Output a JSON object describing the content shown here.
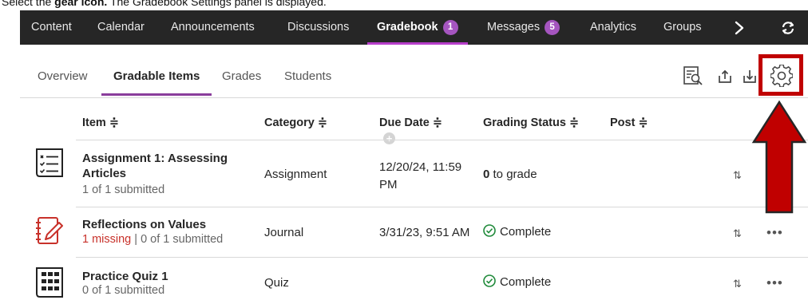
{
  "caption": {
    "prefix": "Select the",
    "bold": "gear icon.",
    "rest": "The Gradebook Settings panel is displayed."
  },
  "top_nav": {
    "tabs": [
      {
        "label": "Content"
      },
      {
        "label": "Calendar"
      },
      {
        "label": "Announcements"
      },
      {
        "label": "Discussions"
      },
      {
        "label": "Gradebook",
        "badge": "1",
        "active": true
      },
      {
        "label": "Messages",
        "badge": "5"
      },
      {
        "label": "Analytics"
      },
      {
        "label": "Groups"
      }
    ],
    "more_icon": "chevron-right-icon",
    "refresh_icon": "refresh-icon"
  },
  "sub_nav": {
    "tabs": [
      {
        "label": "Overview"
      },
      {
        "label": "Gradable Items",
        "active": true
      },
      {
        "label": "Grades"
      },
      {
        "label": "Students"
      }
    ]
  },
  "toolbar": {
    "icons": [
      "review-search-icon",
      "export-icon",
      "import-icon",
      "gear-icon"
    ],
    "highlight_color": "#c00000"
  },
  "table": {
    "headers": {
      "item": "Item ≑",
      "category": "Category ≑",
      "due_date": "Due Date ≑",
      "grading_status": "Grading Status ≑",
      "post": "Post ≑"
    },
    "add_icon": "+",
    "rows": [
      {
        "icon": "assignment-checklist-icon",
        "title": "Assignment 1: Assessing Articles",
        "submitted": "1 of 1 submitted",
        "category": "Assignment",
        "due_date": "12/20/24, 11:59 PM",
        "grade_count": "0",
        "grade_text": " to grade",
        "actions": "⇅"
      },
      {
        "icon": "journal-icon",
        "title": "Reflections on Values",
        "missing": "1 missing",
        "separator": " | ",
        "submitted": "0 of 1 submitted",
        "category": "Journal",
        "due_date": "3/31/23, 9:51 AM",
        "status": "Complete",
        "actions": "⇅",
        "more": "•••"
      },
      {
        "icon": "quiz-icon",
        "title": "Practice Quiz 1",
        "submitted": "0 of 1 submitted",
        "category": "Quiz",
        "status": "Complete",
        "actions": "⇅",
        "more": "•••"
      }
    ]
  },
  "colors": {
    "nav_bg": "#262626",
    "accent_purple": "#b73eca",
    "badge_purple": "#a555bf",
    "missing_red": "#c8312a",
    "complete_green": "#1f8a3a",
    "arrow_red": "#c00000"
  }
}
